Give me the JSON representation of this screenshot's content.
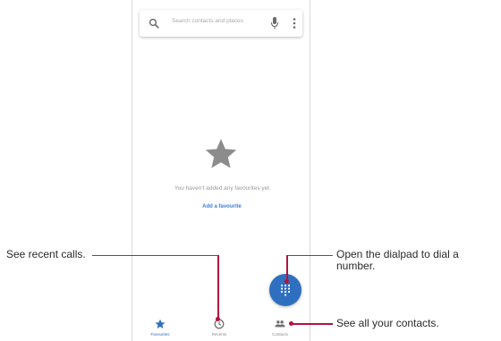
{
  "search": {
    "placeholder": "Search contacts and places"
  },
  "empty_state": {
    "icon": "star-icon",
    "message": "You haven't added any favourites yet",
    "add_link": "Add a favourite"
  },
  "fab": {
    "icon": "dialpad-icon"
  },
  "bottom_nav": {
    "items": [
      {
        "label": "Favourites",
        "icon": "star-icon",
        "active": true
      },
      {
        "label": "Recents",
        "icon": "clock-icon",
        "active": false
      },
      {
        "label": "Contacts",
        "icon": "people-icon",
        "active": false
      }
    ]
  },
  "callouts": {
    "recents": "See recent calls.",
    "dialpad_line1": "Open the dialpad to dial a",
    "dialpad_line2": "number.",
    "contacts": "See all your contacts."
  },
  "colors": {
    "accent": "#2f6fc0",
    "callout": "#b3123f",
    "star": "#8c8c8c"
  }
}
